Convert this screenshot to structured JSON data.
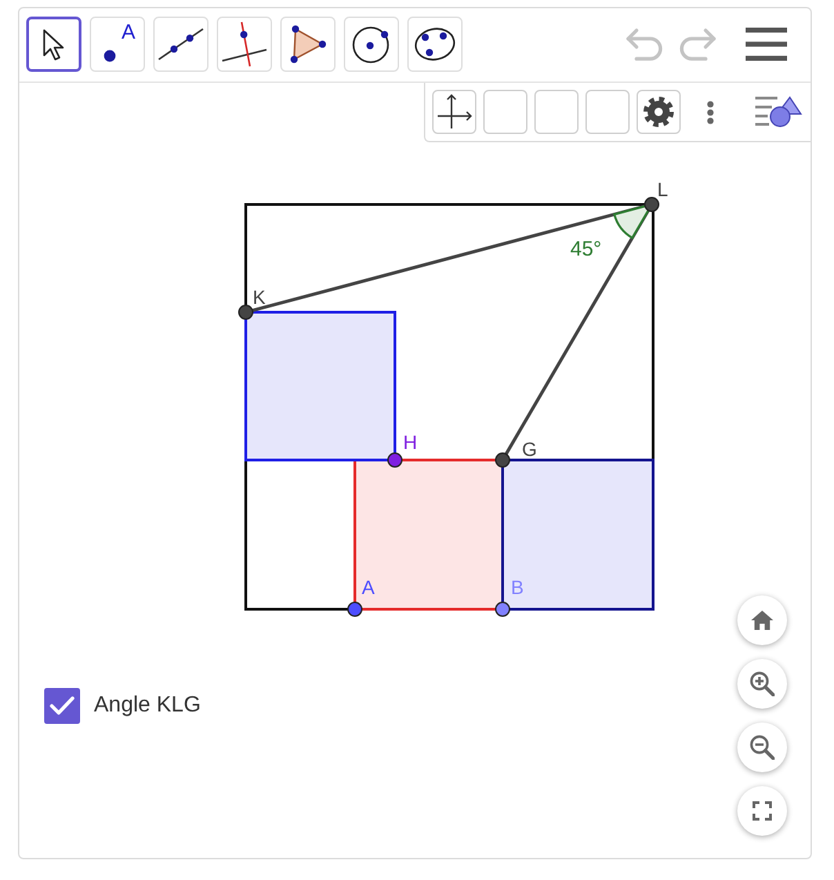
{
  "toolbar": {
    "tools": [
      {
        "kind": "move",
        "selected": true
      },
      {
        "kind": "point",
        "label": "A",
        "selected": false
      },
      {
        "kind": "line",
        "selected": false
      },
      {
        "kind": "perpendicular",
        "selected": false
      },
      {
        "kind": "polygon",
        "selected": false
      },
      {
        "kind": "circle",
        "selected": false
      },
      {
        "kind": "conic",
        "selected": false
      }
    ],
    "history": [
      {
        "kind": "undo",
        "disabled": true
      },
      {
        "kind": "redo",
        "disabled": true
      }
    ]
  },
  "graphics": {
    "points": [
      {
        "label": "L",
        "color": "#444444"
      },
      {
        "label": "K",
        "color": "#444444"
      },
      {
        "label": "H",
        "color": "#7f1fe0"
      },
      {
        "label": "G",
        "color": "#444444"
      },
      {
        "label": "A",
        "color": "#4d4dff"
      },
      {
        "label": "B",
        "color": "#8181ff"
      }
    ],
    "angle": {
      "label": "45°"
    }
  },
  "checkbox": {
    "label": "Angle KLG",
    "checked": true
  }
}
